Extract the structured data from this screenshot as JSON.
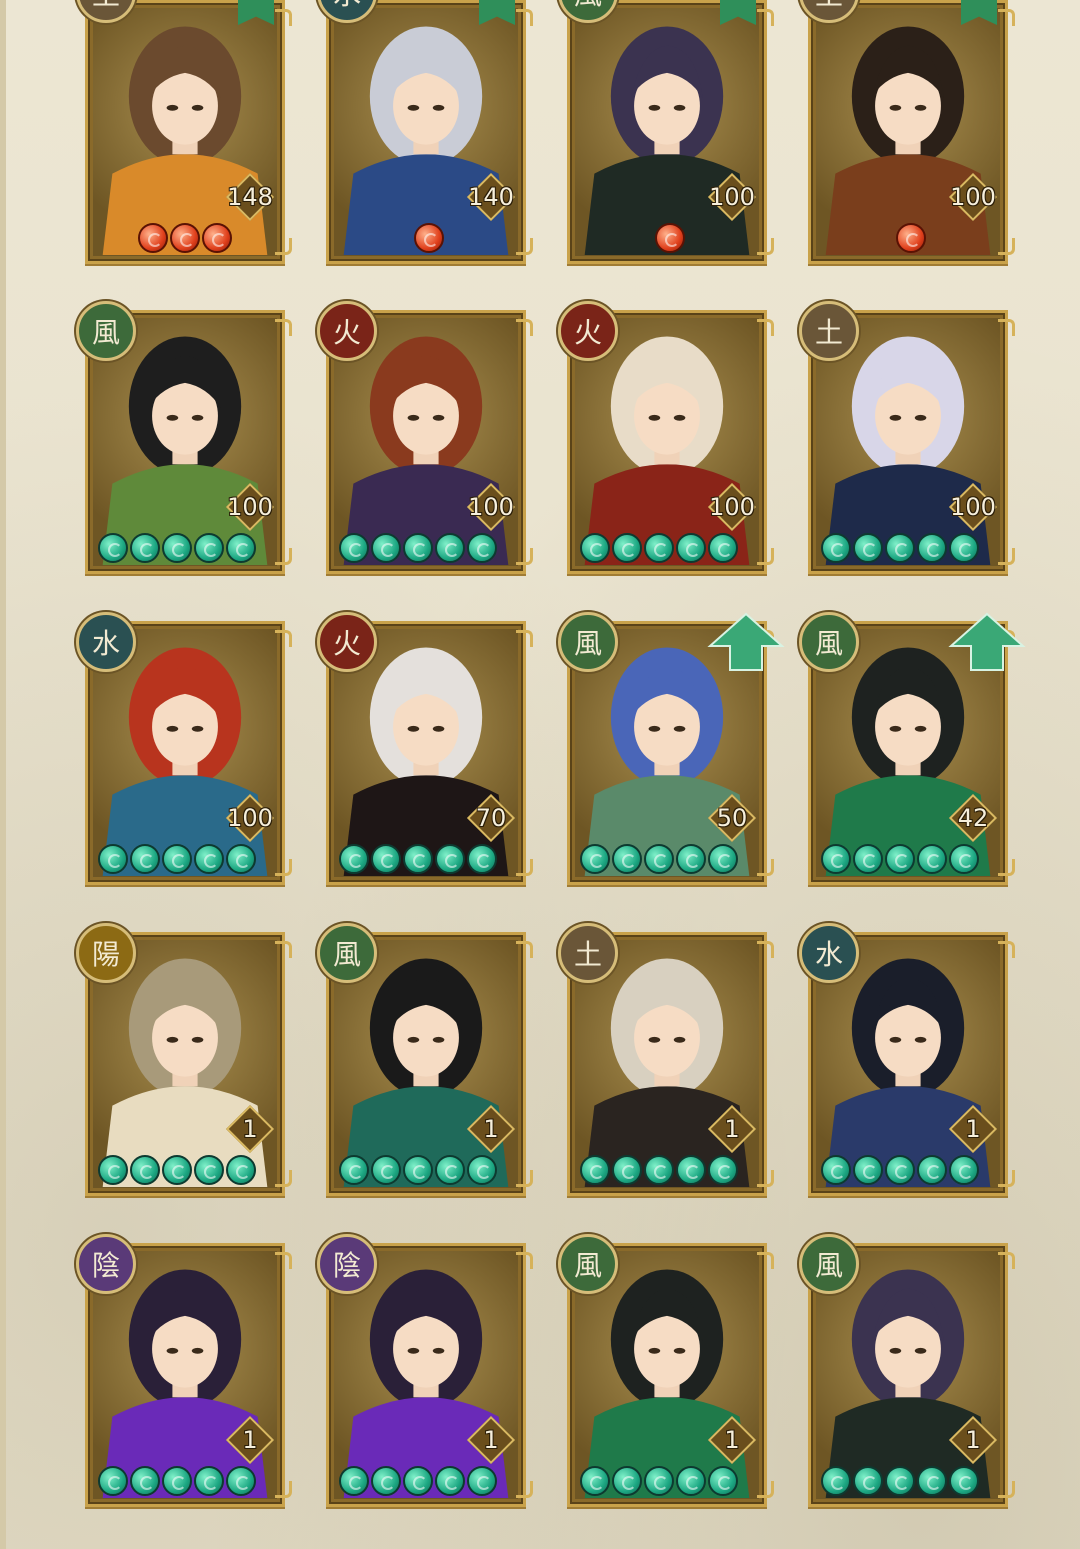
{
  "colors": {
    "background": "#e9e3d0",
    "card_frame": "#c9a24a",
    "jade_orb": "#1da883",
    "fire_orb": "#e0401c",
    "upgrade_arrow": "#3aa876"
  },
  "cards": [
    {
      "element": "土",
      "element_type": "earth",
      "level": "148",
      "stars": 3,
      "star_type": "fire",
      "flag": true,
      "upgrade": false,
      "hair": "#6b4a2e",
      "outfit": "#d98a2a"
    },
    {
      "element": "水",
      "element_type": "water",
      "level": "140",
      "stars": 1,
      "star_type": "fire",
      "flag": true,
      "upgrade": false,
      "hair": "#c9ccd6",
      "outfit": "#2b4a86"
    },
    {
      "element": "風",
      "element_type": "wind",
      "level": "100",
      "stars": 1,
      "star_type": "fire",
      "flag": true,
      "upgrade": false,
      "hair": "#3b3350",
      "outfit": "#1f2a24"
    },
    {
      "element": "土",
      "element_type": "earth",
      "level": "100",
      "stars": 1,
      "star_type": "fire",
      "flag": true,
      "upgrade": false,
      "hair": "#2b2018",
      "outfit": "#7a3e1c"
    },
    {
      "element": "風",
      "element_type": "wind",
      "level": "100",
      "stars": 5,
      "star_type": "jade",
      "flag": false,
      "upgrade": false,
      "hair": "#1e1e1e",
      "outfit": "#5f8a3a"
    },
    {
      "element": "火",
      "element_type": "fire",
      "level": "100",
      "stars": 5,
      "star_type": "jade",
      "flag": false,
      "upgrade": false,
      "hair": "#8a3a1e",
      "outfit": "#3a2a52"
    },
    {
      "element": "火",
      "element_type": "fire",
      "level": "100",
      "stars": 5,
      "star_type": "jade",
      "flag": false,
      "upgrade": false,
      "hair": "#e8dcc8",
      "outfit": "#8a2418"
    },
    {
      "element": "土",
      "element_type": "earth",
      "level": "100",
      "stars": 5,
      "star_type": "jade",
      "flag": false,
      "upgrade": false,
      "hair": "#d8d6e8",
      "outfit": "#1e2a4a"
    },
    {
      "element": "水",
      "element_type": "water",
      "level": "100",
      "stars": 5,
      "star_type": "jade",
      "flag": false,
      "upgrade": false,
      "hair": "#b8341e",
      "outfit": "#2a6a8a"
    },
    {
      "element": "火",
      "element_type": "fire",
      "level": "70",
      "stars": 5,
      "star_type": "jade",
      "flag": false,
      "upgrade": false,
      "hair": "#e4e0dc",
      "outfit": "#1e1616"
    },
    {
      "element": "風",
      "element_type": "wind",
      "level": "50",
      "stars": 5,
      "star_type": "jade",
      "flag": false,
      "upgrade": true,
      "hair": "#4a66b8",
      "outfit": "#5a8a6a"
    },
    {
      "element": "風",
      "element_type": "wind",
      "level": "42",
      "stars": 5,
      "star_type": "jade",
      "flag": false,
      "upgrade": true,
      "hair": "#1e2220",
      "outfit": "#1f7a4a"
    },
    {
      "element": "陽",
      "element_type": "yang",
      "level": "1",
      "stars": 5,
      "star_type": "jade",
      "flag": false,
      "upgrade": false,
      "hair": "#a89a7a",
      "outfit": "#e8dcc0"
    },
    {
      "element": "風",
      "element_type": "wind",
      "level": "1",
      "stars": 5,
      "star_type": "jade",
      "flag": false,
      "upgrade": false,
      "hair": "#1a1a1a",
      "outfit": "#1f6a5a"
    },
    {
      "element": "土",
      "element_type": "earth",
      "level": "1",
      "stars": 5,
      "star_type": "jade",
      "flag": false,
      "upgrade": false,
      "hair": "#d8d0c0",
      "outfit": "#2a2420"
    },
    {
      "element": "水",
      "element_type": "water",
      "level": "1",
      "stars": 5,
      "star_type": "jade",
      "flag": false,
      "upgrade": false,
      "hair": "#1a1e2a",
      "outfit": "#2a3a6a"
    },
    {
      "element": "陰",
      "element_type": "yin",
      "level": "1",
      "stars": 5,
      "star_type": "jade",
      "flag": false,
      "upgrade": false,
      "hair": "#2a2038",
      "outfit": "#6a2ab8"
    },
    {
      "element": "陰",
      "element_type": "yin",
      "level": "1",
      "stars": 5,
      "star_type": "jade",
      "flag": false,
      "upgrade": false,
      "hair": "#2a2038",
      "outfit": "#6a2ab8"
    },
    {
      "element": "風",
      "element_type": "wind",
      "level": "1",
      "stars": 5,
      "star_type": "jade",
      "flag": false,
      "upgrade": false,
      "hair": "#1e2220",
      "outfit": "#1f7a4a"
    },
    {
      "element": "風",
      "element_type": "wind",
      "level": "1",
      "stars": 5,
      "star_type": "jade",
      "flag": false,
      "upgrade": false,
      "hair": "#3b3350",
      "outfit": "#1f2a24"
    }
  ]
}
